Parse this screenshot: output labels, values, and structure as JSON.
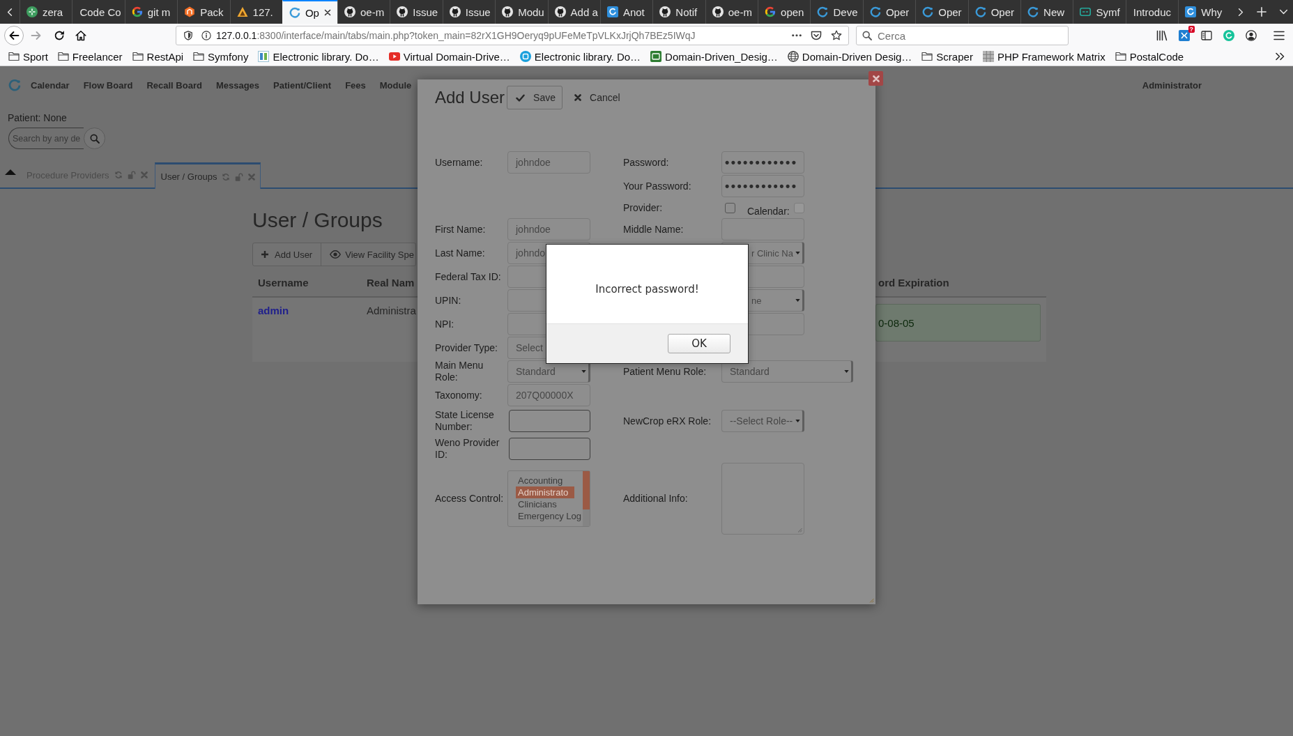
{
  "browser": {
    "tabs": [
      {
        "label": "zera",
        "kind": "flower",
        "selected": false
      },
      {
        "label": "Code Co",
        "kind": "none",
        "selected": false
      },
      {
        "label": "git m",
        "kind": "gmark",
        "selected": false
      },
      {
        "label": "Pack",
        "kind": "hexagon",
        "selected": false
      },
      {
        "label": "127.",
        "kind": "triangle",
        "selected": false
      },
      {
        "label": "Op",
        "kind": "ring",
        "selected": true
      },
      {
        "label": "oe-m",
        "kind": "disc",
        "selected": false
      },
      {
        "label": "Issue",
        "kind": "disc",
        "selected": false
      },
      {
        "label": "Issue",
        "kind": "disc",
        "selected": false
      },
      {
        "label": "Modu",
        "kind": "disc",
        "selected": false
      },
      {
        "label": "Add a",
        "kind": "disc",
        "selected": false
      },
      {
        "label": "Anot",
        "kind": "square",
        "selected": false
      },
      {
        "label": "Notif",
        "kind": "disc",
        "selected": false
      },
      {
        "label": "oe-m",
        "kind": "disc",
        "selected": false
      },
      {
        "label": "open",
        "kind": "gmark",
        "selected": false
      },
      {
        "label": "Deve",
        "kind": "ring",
        "selected": false
      },
      {
        "label": "Oper",
        "kind": "ring",
        "selected": false
      },
      {
        "label": "Oper",
        "kind": "ring",
        "selected": false
      },
      {
        "label": "Oper",
        "kind": "ring",
        "selected": false
      },
      {
        "label": "New",
        "kind": "ring",
        "selected": false
      },
      {
        "label": "Symf",
        "kind": "tile",
        "selected": false
      },
      {
        "label": "Introduc",
        "kind": "none",
        "selected": false
      },
      {
        "label": "Why",
        "kind": "square",
        "selected": false
      }
    ],
    "address": {
      "host": "127.0.0.1",
      "rest": ":8300/interface/main/tabs/main.php?token_main=82rX1GH9Oeryq9pUFeMeTpVLKxJrjQh7BEz5IWqJ"
    },
    "search": {
      "placeholder": "Cerca"
    },
    "extension_badge": "?",
    "bookmarks": [
      {
        "label": "Sport",
        "kind": "folder"
      },
      {
        "label": "Freelancer",
        "kind": "folder"
      },
      {
        "label": "RestApi",
        "kind": "folder"
      },
      {
        "label": "Symfony",
        "kind": "folder"
      },
      {
        "label": "Electronic library. Do…",
        "kind": "tile"
      },
      {
        "label": "Virtual Domain-Drive…",
        "kind": "play"
      },
      {
        "label": "Electronic library. Do…",
        "kind": "disc"
      },
      {
        "label": "Domain-Driven_Desig…",
        "kind": "square"
      },
      {
        "label": "Domain-Driven Desig…",
        "kind": "globe"
      },
      {
        "label": "Scraper",
        "kind": "folder"
      },
      {
        "label": "PHP Framework Matrix",
        "kind": "grid"
      },
      {
        "label": "PostalCode",
        "kind": "folder"
      }
    ]
  },
  "app": {
    "nav": [
      "Calendar",
      "Flow Board",
      "Recall Board",
      "Messages",
      "Patient/Client",
      "Fees",
      "Module"
    ],
    "user": "Administrator",
    "patient": "Patient: None",
    "search": {
      "placeholder": "Search by any de"
    },
    "tabs": [
      {
        "label": "Procedure Providers",
        "selected": false
      },
      {
        "label": "User / Groups",
        "selected": true
      }
    ],
    "title": "User / Groups",
    "actions": [
      {
        "label": "Add User",
        "kind": "add"
      },
      {
        "label": "View Facility Spe",
        "kind": "view"
      }
    ],
    "table": {
      "columns": [
        "Username",
        "Real Nam",
        "ord Expiration"
      ],
      "rows": [
        {
          "cells": [
            {
              "kind": "link",
              "text": "admin"
            },
            {
              "kind": "text",
              "text": "Administra"
            },
            {
              "kind": "status",
              "text": "0-08-05"
            }
          ]
        }
      ]
    }
  },
  "dialog": {
    "title": "Add User",
    "buttons": [
      {
        "label": "Save",
        "kind": "save"
      },
      {
        "label": "Cancel",
        "kind": "cancel"
      }
    ],
    "rows": [
      {
        "left": {
          "label": "Username:",
          "kind": "text",
          "value": "johndoe"
        },
        "right": {
          "label": "Password:",
          "kind": "password",
          "value": "••••••••••••"
        }
      },
      {
        "right": {
          "label": "Your Password:",
          "kind": "password",
          "value": "••••••••••••"
        }
      },
      {
        "right": {
          "label": "Provider:",
          "kind": "checkboxes",
          "boxes": [
            {
              "checked": false,
              "disabled": false
            },
            {
              "label": "Calendar:",
              "checked": false,
              "disabled": true
            }
          ]
        }
      },
      {
        "left": {
          "label": "First Name:",
          "kind": "text",
          "value": "johndoe"
        },
        "right": {
          "label": "Middle Name:",
          "kind": "text"
        }
      },
      {
        "left": {
          "label": "Last Name:",
          "kind": "text",
          "value": "johndo"
        },
        "right": {
          "kind": "select",
          "value": "r Clinic Na",
          "covered": true
        }
      },
      {
        "left": {
          "label": "Federal Tax ID:",
          "kind": "text"
        },
        "right": {
          "kind": "text"
        }
      },
      {
        "left": {
          "label": "UPIN:",
          "kind": "text"
        },
        "right": {
          "kind": "select",
          "value": "ne",
          "covered": true
        }
      },
      {
        "left": {
          "label": "NPI:",
          "kind": "text"
        },
        "right": {
          "kind": "text"
        }
      },
      {
        "left": {
          "label": "Provider Type:",
          "kind": "select",
          "value": "Select"
        }
      },
      {
        "left": {
          "label": "Main Menu Role:",
          "kind": "select",
          "value": "Standard"
        },
        "right": {
          "label": "Patient Menu Role:",
          "kind": "select",
          "value": "Standard",
          "wide": true
        }
      },
      {
        "left": {
          "label": "Taxonomy:",
          "kind": "text",
          "value": "207Q00000X"
        }
      },
      {
        "left": {
          "label": "State License Number:",
          "kind": "plain"
        },
        "right": {
          "label": "NewCrop eRX Role:",
          "kind": "select",
          "value": "--Select Role--"
        }
      },
      {
        "left": {
          "label": "Weno Provider ID:",
          "kind": "plain"
        }
      },
      {
        "left": {
          "label": "Access Control:",
          "kind": "listbox",
          "options": [
            {
              "label": "Accounting",
              "selected": false
            },
            {
              "label": "Administrato",
              "selected": true
            },
            {
              "label": "Clinicians",
              "selected": false
            },
            {
              "label": "Emergency Log",
              "selected": false
            }
          ]
        },
        "right": {
          "label": "Additional Info:",
          "kind": "textarea"
        }
      }
    ]
  },
  "alert": {
    "message": "Incorrect password!",
    "button": "OK"
  }
}
